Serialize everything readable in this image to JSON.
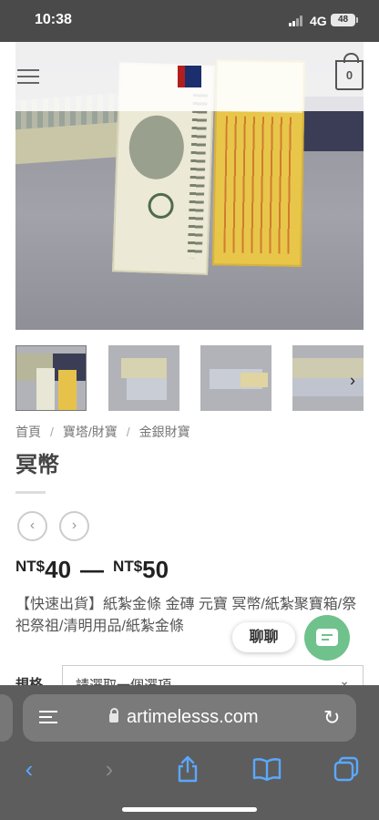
{
  "status_bar": {
    "time": "10:38",
    "network": "4G",
    "battery": "48"
  },
  "header": {
    "cart_count": "0"
  },
  "breadcrumb": {
    "items": [
      "首頁",
      "寶塔/財寶",
      "金銀財寶"
    ],
    "separator": "/"
  },
  "product": {
    "title": "冥幣",
    "price": {
      "currency": "NT$",
      "min": "40",
      "max": "50",
      "dash": "—"
    },
    "description": "【快速出貨】紙紮金條 金磚 元寶 冥幣/紙紮聚寶箱/祭祀祭祖/清明用品/紙紮金條"
  },
  "gallery": {
    "prev_label": "‹",
    "next_label": "›",
    "thumb_next": "›"
  },
  "variation": {
    "label": "規格",
    "placeholder": "請選取一個選項"
  },
  "chat": {
    "label": "聊聊"
  },
  "browser": {
    "url": "artimelesss.com"
  },
  "colors": {
    "chat_green": "#6fc28b",
    "safari_blue": "#5aa8ff",
    "status_bar": "#4a4a4a"
  }
}
